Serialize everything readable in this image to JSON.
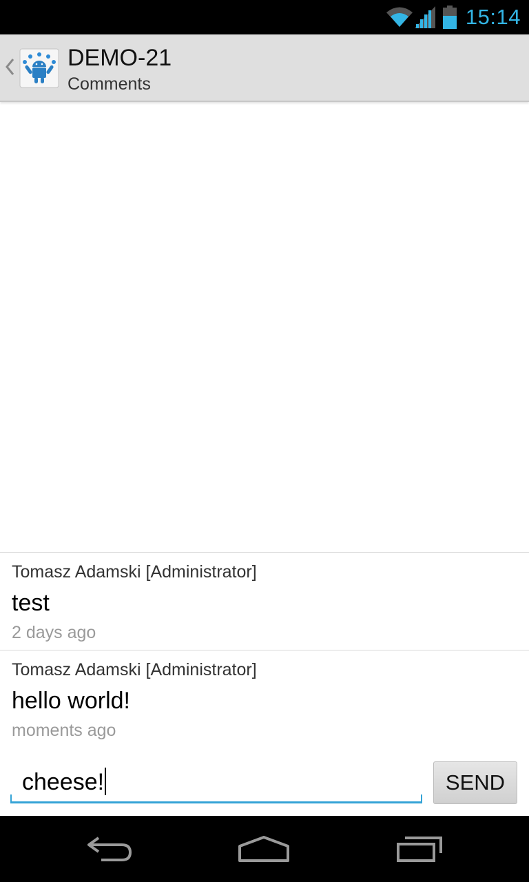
{
  "status_bar": {
    "time": "15:14",
    "accent_color": "#33b5e5",
    "icons": [
      "wifi-icon",
      "signal-icon",
      "battery-icon"
    ]
  },
  "action_bar": {
    "title": "DEMO-21",
    "subtitle": "Comments",
    "icons": [
      "up-caret-icon",
      "android-app-icon"
    ]
  },
  "comments": [
    {
      "author": "Tomasz Adamski [Administrator]",
      "body": "test",
      "time": "2 days ago"
    },
    {
      "author": "Tomasz Adamski [Administrator]",
      "body": "hello world!",
      "time": "moments ago"
    }
  ],
  "compose": {
    "input_value": "cheese!",
    "send_label": "SEND",
    "underline_color": "#33a3d6"
  },
  "nav_bar": {
    "icons": [
      "back-icon",
      "home-icon",
      "recent-apps-icon"
    ]
  }
}
